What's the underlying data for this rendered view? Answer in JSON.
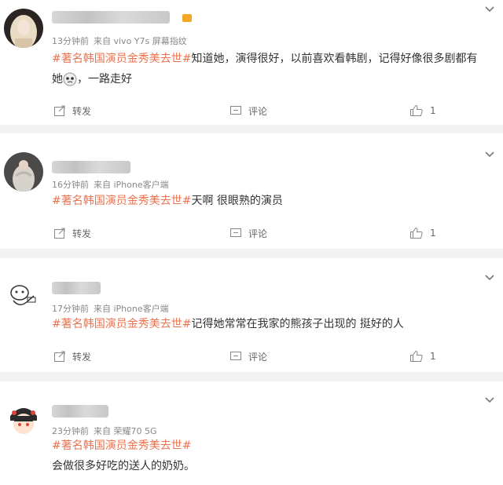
{
  "actions": {
    "repost_label": "转发",
    "comment_label": "评论"
  },
  "hashtag": "#著名韩国演员金秀美去世#",
  "comments": [
    {
      "time": "13分钟前",
      "source": "来自 vivo Y7s 屏幕指纹",
      "text_line1": "知道她，演得很好，以前喜欢看韩剧，记得好像很多剧都有",
      "text_line2_prefix": "她",
      "text_line2_suffix": "，一路走好",
      "likes": "1"
    },
    {
      "time": "16分钟前",
      "source": "来自 iPhone客户端",
      "text": "天啊 很眼熟的演员",
      "likes": "1"
    },
    {
      "time": "17分钟前",
      "source": "来自 iPhone客户端",
      "text": "记得她常常在我家的熊孩子出现的 挺好的人",
      "likes": "1"
    },
    {
      "time": "23分钟前",
      "source": "来自 荣耀70 5G",
      "text": "会做很多好吃的送人的奶奶。"
    }
  ]
}
